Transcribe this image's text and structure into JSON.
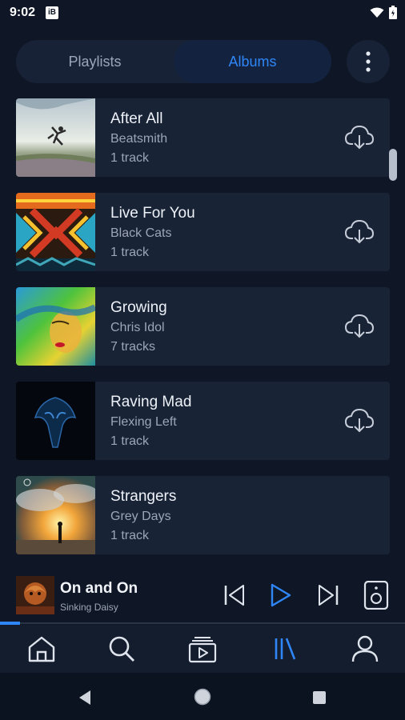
{
  "status": {
    "time": "9:02",
    "badge": "iB"
  },
  "tabs": {
    "playlists": "Playlists",
    "albums": "Albums",
    "active": "Albums"
  },
  "albums": [
    {
      "title": "After All",
      "artist": "Beatsmith",
      "count": "1 track"
    },
    {
      "title": "Live For You",
      "artist": "Black Cats",
      "count": "1 track"
    },
    {
      "title": "Growing",
      "artist": "Chris Idol",
      "count": "7 tracks"
    },
    {
      "title": "Raving Mad",
      "artist": "Flexing Left",
      "count": "1 track"
    },
    {
      "title": "Strangers",
      "artist": "Grey Days",
      "count": "1 track"
    }
  ],
  "now_playing": {
    "title": "On and On",
    "artist": "Sinking Daisy",
    "progress": 0.05
  },
  "colors": {
    "accent": "#2f86f6",
    "background": "#0f1727",
    "card": "#182336"
  },
  "icons": {
    "more": "more-vert-icon",
    "download": "cloud-download-icon",
    "prev": "skip-previous-icon",
    "play": "play-icon",
    "next": "skip-next-icon",
    "speaker": "speaker-icon",
    "home": "home-icon",
    "search": "search-icon",
    "queue": "queue-play-icon",
    "library": "library-icon",
    "profile": "profile-icon"
  }
}
